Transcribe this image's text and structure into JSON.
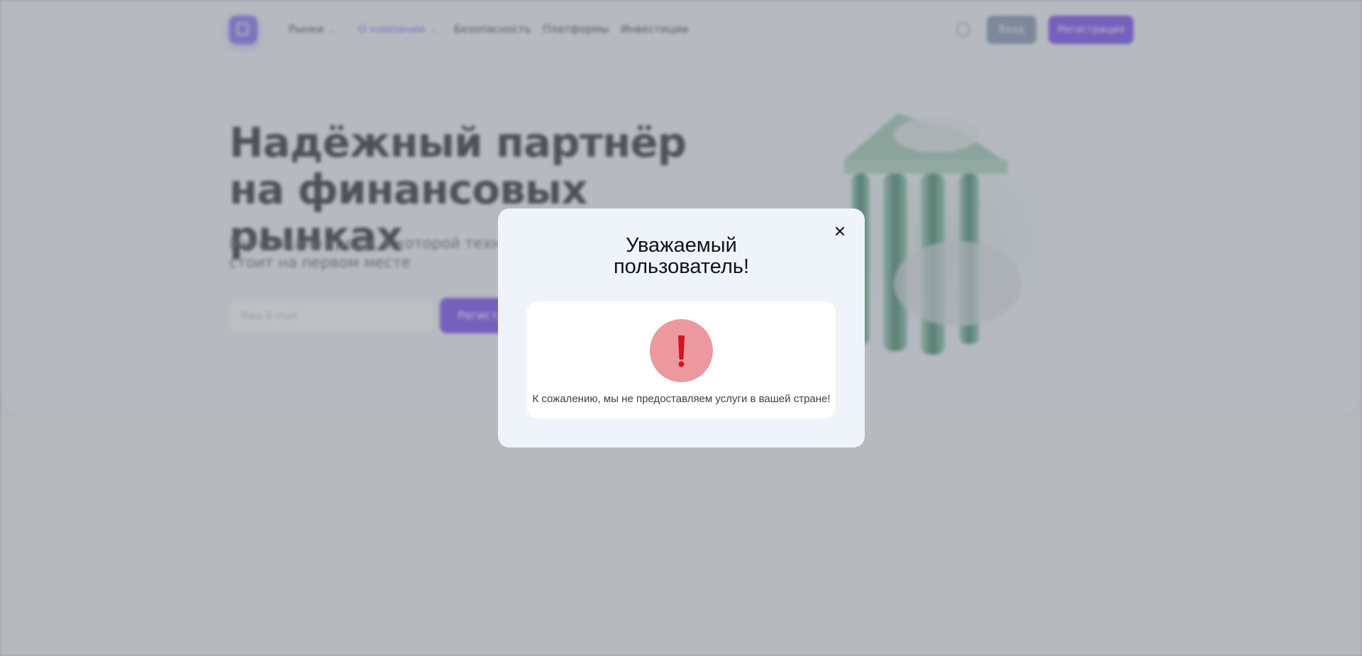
{
  "nav": {
    "items": [
      {
        "label": "Рынки",
        "has_dropdown": true
      },
      {
        "label": "О компании",
        "has_dropdown": true,
        "active": true
      },
      {
        "label": "Безопасность"
      },
      {
        "label": "Платформы"
      },
      {
        "label": "Инвестиции"
      }
    ],
    "login_label": "Вход",
    "register_label": "Регистрация"
  },
  "hero": {
    "title": "Надёжный партнёр на финансовых рынках",
    "subtitle": "Мы создали среду, в которой техн... клиента стоит на первом месте",
    "email_placeholder": "Ваш E-mail",
    "cta_label": "Регистр..."
  },
  "modal": {
    "title_line1": "Уважаемый",
    "title_line2": "пользователь!",
    "message": "К сожалению, мы не предоставляем услуги в вашей стране!",
    "icon": "exclamation-alert-icon",
    "close_icon": "close-icon"
  },
  "colors": {
    "accent": "#6a42f4",
    "alert_circle": "#eb999e",
    "alert_mark": "#d8121e",
    "modal_bg": "#eff4fa"
  }
}
